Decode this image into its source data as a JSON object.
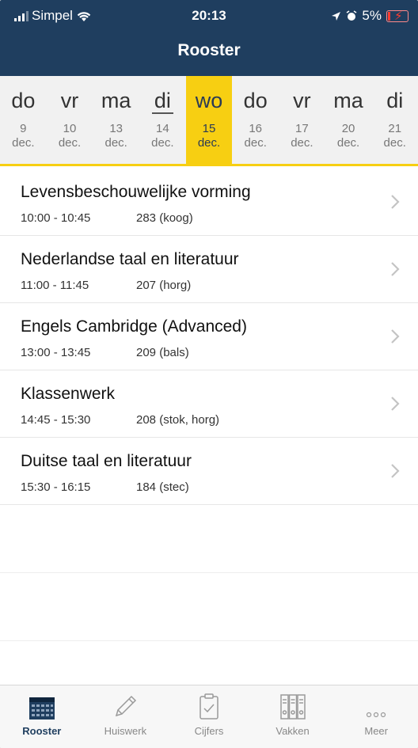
{
  "status_bar": {
    "carrier": "Simpel",
    "time": "20:13",
    "battery": "5%"
  },
  "header": {
    "title": "Rooster"
  },
  "colors": {
    "header_bg": "#1f3e5f",
    "selected_day": "#f7cf12",
    "tab_active": "#1f3e5f"
  },
  "days": [
    {
      "name": "do",
      "num": "9",
      "month": "dec."
    },
    {
      "name": "vr",
      "num": "10",
      "month": "dec."
    },
    {
      "name": "ma",
      "num": "13",
      "month": "dec."
    },
    {
      "name": "di",
      "num": "14",
      "month": "dec."
    },
    {
      "name": "wo",
      "num": "15",
      "month": "dec."
    },
    {
      "name": "do",
      "num": "16",
      "month": "dec."
    },
    {
      "name": "vr",
      "num": "17",
      "month": "dec."
    },
    {
      "name": "ma",
      "num": "20",
      "month": "dec."
    },
    {
      "name": "di",
      "num": "21",
      "month": "dec."
    }
  ],
  "lessons": [
    {
      "subject": "Levensbeschouwelijke vorming",
      "time": "10:00 - 10:45",
      "room": "283 (koog)"
    },
    {
      "subject": "Nederlandse taal en literatuur",
      "time": "11:00 - 11:45",
      "room": "207 (horg)"
    },
    {
      "subject": "Engels Cambridge (Advanced)",
      "time": "13:00 - 13:45",
      "room": "209 (bals)"
    },
    {
      "subject": "Klassenwerk",
      "time": "14:45 - 15:30",
      "room": "208 (stok, horg)"
    },
    {
      "subject": "Duitse taal en literatuur",
      "time": "15:30 - 16:15",
      "room": "184 (stec)"
    }
  ],
  "tabs": [
    {
      "label": "Rooster",
      "icon": "calendar-grid-icon"
    },
    {
      "label": "Huiswerk",
      "icon": "pencil-icon"
    },
    {
      "label": "Cijfers",
      "icon": "checklist-icon"
    },
    {
      "label": "Vakken",
      "icon": "binders-icon"
    },
    {
      "label": "Meer",
      "icon": "more-dots-icon"
    }
  ]
}
